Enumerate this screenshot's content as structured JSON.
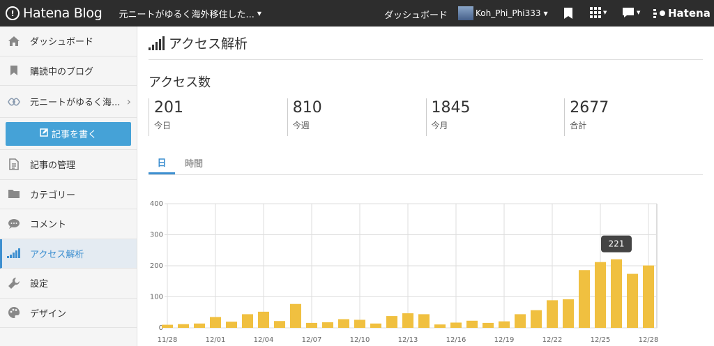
{
  "topbar": {
    "logo_text": "Hatena Blog",
    "blog_title": "元ニートがゆるく海外移住した...",
    "dashboard_link": "ダッシュボード",
    "username": "Koh_Phi_Phi333",
    "brand": "Hatena"
  },
  "sidebar": {
    "items": [
      {
        "label": "ダッシュボード",
        "icon": "home-icon"
      },
      {
        "label": "購読中のブログ",
        "icon": "bookmark-icon"
      },
      {
        "label": "元ニートがゆるく海...",
        "icon": "blog-avatar-icon"
      },
      {
        "label": "記事を書く",
        "icon": "edit-icon"
      },
      {
        "label": "記事の管理",
        "icon": "document-icon"
      },
      {
        "label": "カテゴリー",
        "icon": "folder-icon"
      },
      {
        "label": "コメント",
        "icon": "comment-icon"
      },
      {
        "label": "アクセス解析",
        "icon": "bar-chart-icon"
      },
      {
        "label": "設定",
        "icon": "wrench-icon"
      },
      {
        "label": "デザイン",
        "icon": "palette-icon"
      }
    ]
  },
  "main": {
    "title": "アクセス解析",
    "section_title": "アクセス数",
    "stats": [
      {
        "value": "201",
        "label": "今日"
      },
      {
        "value": "810",
        "label": "今週"
      },
      {
        "value": "1845",
        "label": "今月"
      },
      {
        "value": "2677",
        "label": "合計"
      }
    ],
    "tabs": [
      {
        "label": "日",
        "active": true
      },
      {
        "label": "時間",
        "active": false
      }
    ],
    "tooltip": "221"
  },
  "colors": {
    "bar": "#f0c040",
    "accent": "#3d8fd0",
    "topbar": "#2d2d2d",
    "write_button": "#45a2d7"
  },
  "chart_data": {
    "type": "bar",
    "categories": [
      "11/28",
      "11/29",
      "11/30",
      "12/01",
      "12/02",
      "12/03",
      "12/04",
      "12/05",
      "12/06",
      "12/07",
      "12/08",
      "12/09",
      "12/10",
      "12/11",
      "12/12",
      "12/13",
      "12/14",
      "12/15",
      "12/16",
      "12/17",
      "12/18",
      "12/19",
      "12/20",
      "12/21",
      "12/22",
      "12/23",
      "12/24",
      "12/25",
      "12/26",
      "12/27",
      "12/28"
    ],
    "tick_labels": [
      "11/28",
      "12/01",
      "12/04",
      "12/07",
      "12/10",
      "12/13",
      "12/16",
      "12/19",
      "12/22",
      "12/25",
      "12/28"
    ],
    "values": [
      10,
      12,
      14,
      35,
      20,
      44,
      52,
      22,
      77,
      16,
      18,
      28,
      26,
      14,
      38,
      47,
      44,
      11,
      17,
      23,
      16,
      21,
      44,
      57,
      89,
      92,
      186,
      212,
      221,
      174,
      201
    ],
    "ylim": [
      0,
      400
    ],
    "yticks": [
      0,
      100,
      200,
      300,
      400
    ],
    "grid": true,
    "highlight_index": 28
  }
}
